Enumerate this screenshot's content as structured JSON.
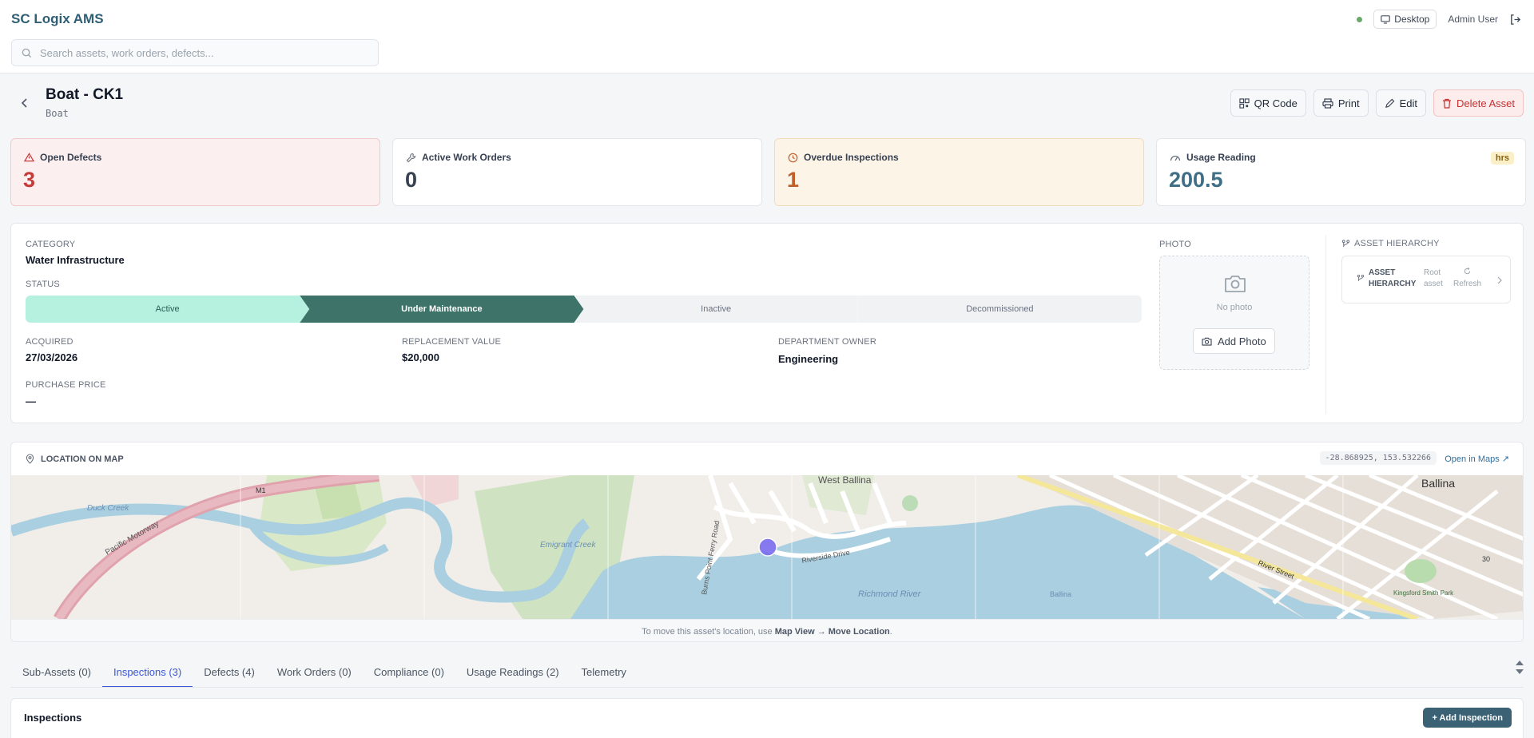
{
  "app": {
    "title": "SC Logix AMS"
  },
  "search": {
    "placeholder": "Search assets, work orders, defects..."
  },
  "topbar": {
    "device_label": "Desktop",
    "user_label": "Admin User"
  },
  "asset": {
    "title": "Boat - CK1",
    "subtitle": "Boat"
  },
  "actions": {
    "qr": "QR Code",
    "print": "Print",
    "edit": "Edit",
    "delete": "Delete Asset"
  },
  "stats": {
    "open_defects": {
      "label": "Open Defects",
      "value": "3"
    },
    "active_work_orders": {
      "label": "Active Work Orders",
      "value": "0"
    },
    "overdue_inspections": {
      "label": "Overdue Inspections",
      "value": "1"
    },
    "usage_reading": {
      "label": "Usage Reading",
      "value": "200.5",
      "unit": "hrs"
    }
  },
  "details": {
    "category_label": "CATEGORY",
    "category": "Water Infrastructure",
    "status_label": "STATUS",
    "stages": [
      "Active",
      "Under Maintenance",
      "Inactive",
      "Decommissioned"
    ],
    "current_stage": "Under Maintenance",
    "acquired_label": "ACQUIRED",
    "acquired": "27/03/2026",
    "replacement_label": "REPLACEMENT VALUE",
    "replacement": "$20,000",
    "department_label": "DEPARTMENT OWNER",
    "department": "Engineering",
    "purchase_label": "PURCHASE PRICE",
    "purchase": "—"
  },
  "photo": {
    "label": "PHOTO",
    "empty": "No photo",
    "add": "Add Photo"
  },
  "hierarchy": {
    "label": "ASSET HIERARCHY",
    "card_title_1": "ASSET",
    "card_title_2": "HIERARCHY",
    "root_1": "Root",
    "root_2": "asset",
    "refresh": "Refresh"
  },
  "map": {
    "title": "LOCATION ON MAP",
    "coords": "-28.868925, 153.532266",
    "open": "Open in Maps ↗",
    "footer_pre": "To move this asset's location, use ",
    "footer_bold": "Map View → Move Location",
    "footer_post": ".",
    "labels": {
      "west_ballina": "West Ballina",
      "ballina": "Ballina",
      "duck_creek": "Duck Creek",
      "pacific_motorway": "Pacific Motorway",
      "emigrant_creek": "Emigrant Creek",
      "richmond_river": "Richmond River",
      "river_street": "River Street",
      "riverside_drive": "Riverside Drive",
      "burns_point_ferry_road": "Burns Point Ferry Road",
      "kingsford_smith_park": "Kingsford Smith Park",
      "m1": "M1",
      "road_30": "30",
      "ballina_water": "Ballina"
    }
  },
  "tabs": [
    "Sub-Assets (0)",
    "Inspections (3)",
    "Defects (4)",
    "Work Orders (0)",
    "Compliance (0)",
    "Usage Readings (2)",
    "Telemetry"
  ],
  "active_tab": "Inspections (3)",
  "inspections": {
    "title": "Inspections",
    "add": "+ Add Inspection"
  },
  "colors": {
    "brand": "#2f5f75",
    "danger": "#c73a3a",
    "warning": "#c05f2a",
    "accent_tab": "#3b56d6",
    "marker": "#7b6cf0"
  }
}
